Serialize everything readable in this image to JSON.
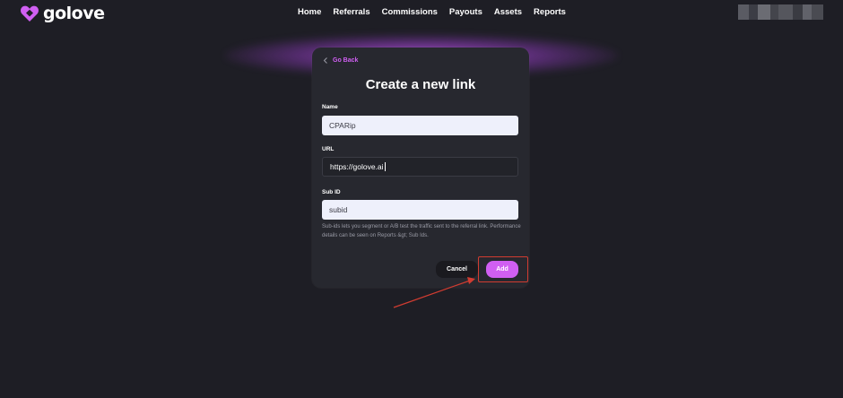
{
  "brand": {
    "name": "golove",
    "accent": "#d05ff2"
  },
  "nav": [
    {
      "label": "Home"
    },
    {
      "label": "Referrals"
    },
    {
      "label": "Commissions"
    },
    {
      "label": "Payouts"
    },
    {
      "label": "Assets"
    },
    {
      "label": "Reports"
    }
  ],
  "account": {
    "icon": "blurred-account-icon"
  },
  "modal": {
    "back_label": "Go Back",
    "title": "Create a new link",
    "name": {
      "label": "Name",
      "value": "CPARip"
    },
    "url": {
      "label": "URL",
      "value": "https://golove.ai"
    },
    "sub_id": {
      "label": "Sub ID",
      "value": "subid"
    },
    "helper_text": "Sub-ids lets you segment or A/B test the traffic sent to the referral link. Performance details can be seen on Reports &gt; Sub Ids.",
    "cancel_label": "Cancel",
    "add_label": "Add"
  },
  "annotation": {
    "highlight_color": "#d13c31",
    "arrow_color": "#d13c31"
  }
}
